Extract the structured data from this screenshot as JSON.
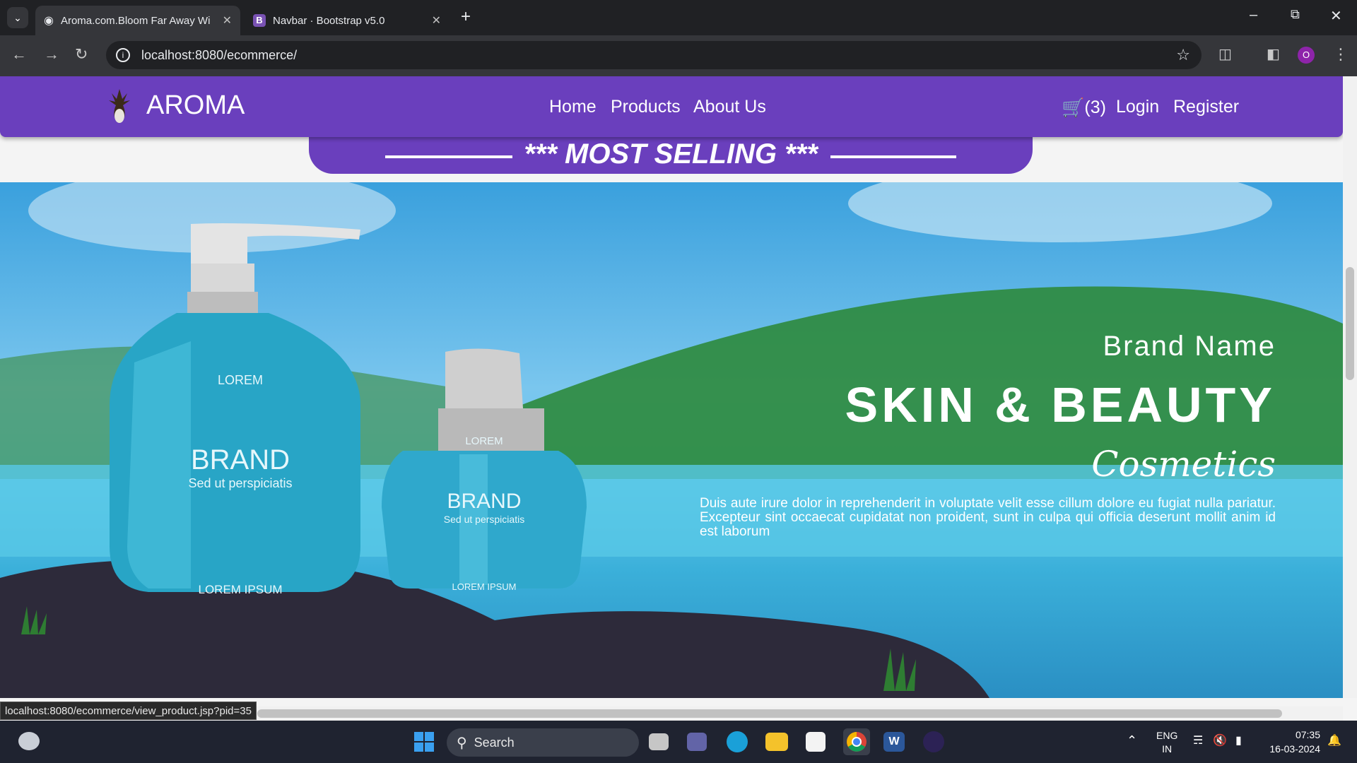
{
  "browser": {
    "tabs": [
      {
        "title": "Aroma.com.Bloom Far Away Wi",
        "favicon": "globe-icon"
      },
      {
        "title": "Navbar · Bootstrap v5.0",
        "favicon": "bootstrap-icon"
      }
    ],
    "url": "localhost:8080/ecommerce/",
    "status_url": "localhost:8080/ecommerce/view_product.jsp?pid=35",
    "profile_initial": "O"
  },
  "site": {
    "brand": "AROMA",
    "nav_links": [
      "Home",
      "Products",
      "About Us"
    ],
    "cart_label": "(3)",
    "login": "Login",
    "register": "Register",
    "banner_heading": "*** MOST SELLING ***"
  },
  "hero": {
    "brand_name": "Brand Name",
    "headline": "SKIN & BEAUTY",
    "script": "Cosmetics",
    "body": "Duis aute irure dolor in reprehenderit in voluptate velit esse cillum dolore eu fugiat nulla pariatur. Excepteur sint occaecat cupidatat non proident, sunt in culpa qui officia deserunt mollit anim id est laborum",
    "bottle_large": {
      "top": "LOREM",
      "brand": "BRAND",
      "tagline": "Sed ut perspiciatis",
      "bottom": "LOREM IPSUM"
    },
    "bottle_small": {
      "top": "LOREM",
      "brand": "BRAND",
      "tagline": "Sed ut perspiciatis",
      "bottom": "LOREM IPSUM"
    }
  },
  "taskbar": {
    "search_placeholder": "Search",
    "lang_top": "ENG",
    "lang_bottom": "IN",
    "time": "07:35",
    "date": "16-03-2024"
  },
  "colors": {
    "navbar": "#6a3fbd",
    "browser_dark": "#202124"
  }
}
